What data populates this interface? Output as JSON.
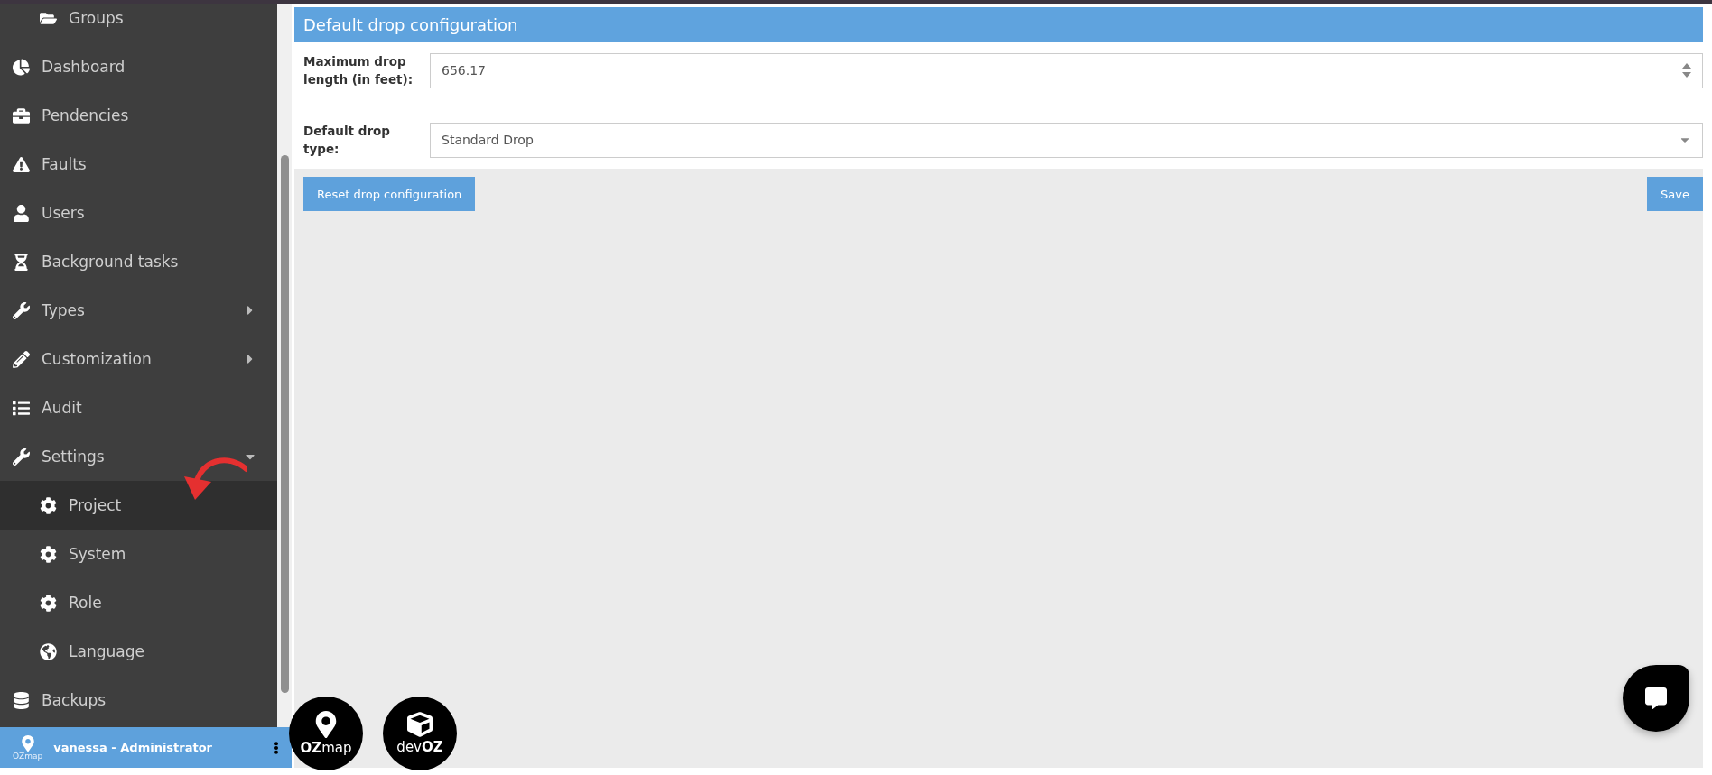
{
  "sidebar": {
    "items": [
      {
        "children": [
          {
            "label": "Groups",
            "selected": false
          }
        ]
      },
      {
        "label": "Dashboard",
        "selected": false
      },
      {
        "label": "Pendencies",
        "selected": false
      },
      {
        "label": "Faults",
        "selected": false
      },
      {
        "label": "Users",
        "selected": false
      },
      {
        "label": "Background tasks",
        "selected": false
      },
      {
        "label": "Types",
        "selected": false,
        "expanded": false
      },
      {
        "label": "Customization",
        "selected": false,
        "expanded": false
      },
      {
        "label": "Audit",
        "selected": false
      },
      {
        "label": "Settings",
        "selected": false,
        "expanded": true,
        "children": [
          {
            "label": "Project",
            "selected": true
          },
          {
            "label": "System",
            "selected": false
          },
          {
            "label": "Role",
            "selected": false
          },
          {
            "label": "Language",
            "selected": false
          }
        ]
      },
      {
        "label": "Backups",
        "selected": false
      }
    ],
    "footer": {
      "logo_text": "OZmap",
      "user": "vanessa - Administrator"
    }
  },
  "panel": {
    "title": "Default drop configuration",
    "fields": [
      {
        "kind": "number",
        "label": "Maximum drop length (in feet):",
        "value": "656.17"
      },
      {
        "kind": "select",
        "label": "Default drop type:",
        "value": "Standard Drop"
      }
    ],
    "buttons": [
      {
        "label": "Reset drop configuration"
      },
      {
        "label": "Save"
      }
    ]
  },
  "logos": [
    {
      "text": "**OZ**map"
    },
    {
      "text": "dev**OZ**"
    }
  ]
}
